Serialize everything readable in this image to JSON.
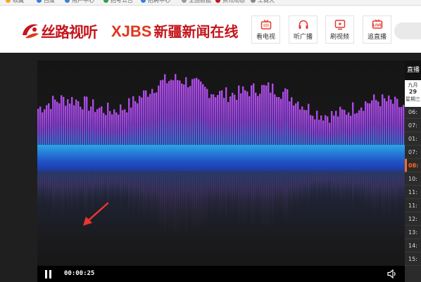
{
  "bookmarks": [
    {
      "label": "收藏",
      "color": "#f5a623"
    },
    {
      "label": "百度",
      "color": "#3b7ddd"
    },
    {
      "label": "用户中心",
      "color": "#3b7ddd"
    },
    {
      "label": "招考公告",
      "color": "#2f9e44"
    },
    {
      "label": "招聘中心",
      "color": "#3b7ddd"
    },
    {
      "label": "全国数据",
      "color": "#999999"
    },
    {
      "label": "资讯动态",
      "color": "#c4161c"
    },
    {
      "label": "工商大",
      "color": "#888888"
    }
  ],
  "header": {
    "logo_text": "丝路视听",
    "brand_latin": "XJBS",
    "brand_cn": "新疆新闻在线",
    "nav": [
      {
        "label": "看电视",
        "icon": "tv-icon"
      },
      {
        "label": "听广播",
        "icon": "headphones-icon"
      },
      {
        "label": "刷视频",
        "icon": "play-screen-icon"
      },
      {
        "label": "追直播",
        "icon": "live-icon"
      }
    ]
  },
  "player": {
    "current_time": "00:00:25",
    "colors": {
      "accent": "#ff6a1f",
      "wave_purple": "#9b45d9",
      "wave_blue": "#2a72d8"
    }
  },
  "side": {
    "title": "直播",
    "month": "九月",
    "day": "29",
    "weekday": "星期三",
    "schedule": [
      {
        "time": "06:"
      },
      {
        "time": "07:"
      },
      {
        "time": "01:"
      },
      {
        "time": "07:"
      },
      {
        "time": "08:",
        "active": true
      },
      {
        "time": "10:"
      },
      {
        "time": "11:"
      },
      {
        "time": "11:"
      },
      {
        "time": "12:"
      },
      {
        "time": "13:"
      },
      {
        "time": "14:"
      },
      {
        "time": "15:"
      }
    ]
  }
}
